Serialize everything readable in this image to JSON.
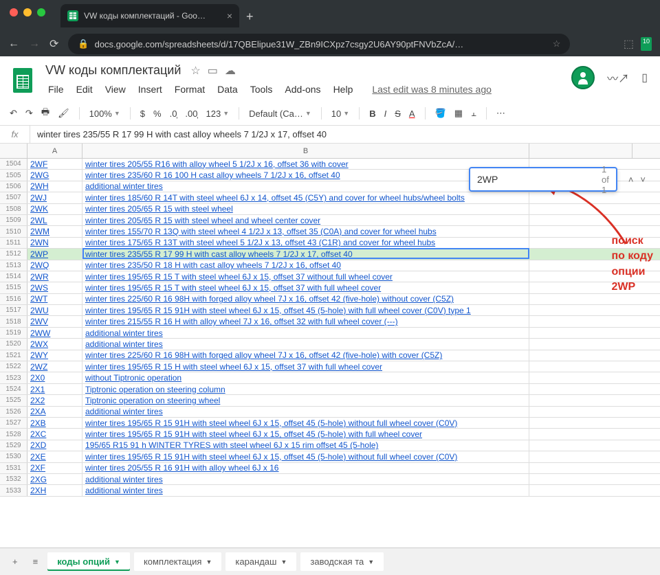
{
  "browser": {
    "tab_title": "VW коды комплектаций - Goo…",
    "url": "docs.google.com/spreadsheets/d/17QBElipue31W_ZBn9ICXpz7csgy2U6AY90ptFNVbZcA/…",
    "ext_badge": "10"
  },
  "doc": {
    "title": "VW коды комплектаций",
    "last_edit": "Last edit was 8 minutes ago",
    "menu": [
      "File",
      "Edit",
      "View",
      "Insert",
      "Format",
      "Data",
      "Tools",
      "Add-ons",
      "Help"
    ]
  },
  "toolbar": {
    "zoom": "100%",
    "font": "Default (Ca…",
    "size": "10"
  },
  "formula": "winter tires 235/55 R 17 99 H with cast alloy wheels 7 1/2J x 17, offset 40",
  "find": {
    "value": "2WP",
    "count": "1 of 1"
  },
  "columns": [
    "A",
    "B"
  ],
  "active_cell": {
    "row": 1512,
    "col": "B"
  },
  "highlight_row": 1512,
  "rows": [
    {
      "n": 1504,
      "a": "2WF",
      "b": "winter tires 205/55 R16 with alloy wheel 5 1/2J x 16, offset 36 with cover"
    },
    {
      "n": 1505,
      "a": "2WG",
      "b": "winter tires 235/60 R 16 100 H cast alloy wheels 7 1/2J x 16, offset 40"
    },
    {
      "n": 1506,
      "a": "2WH",
      "b": "additional winter tires"
    },
    {
      "n": 1507,
      "a": "2WJ",
      "b": "winter tires 185/60 R 14T with steel wheel 6J x 14, offset 45 (C5Y) and cover for wheel hubs/wheel bolts"
    },
    {
      "n": 1508,
      "a": "2WK",
      "b": "winter tires 205/65 R 15 with steel wheel"
    },
    {
      "n": 1509,
      "a": "2WL",
      "b": "winter tires 205/65 R 15 with steel wheel and wheel center cover"
    },
    {
      "n": 1510,
      "a": "2WM",
      "b": "winter tires 155/70 R 13Q with steel wheel 4 1/2J x 13, offset 35 (C0A) and cover for wheel hubs"
    },
    {
      "n": 1511,
      "a": "2WN",
      "b": "winter tires 175/65 R 13T with steel wheel 5 1/2J x 13, offset 43 (C1R) and cover for wheel hubs"
    },
    {
      "n": 1512,
      "a": "2WP",
      "b": "winter tires 235/55 R 17 99 H with cast alloy wheels 7 1/2J x 17, offset 40"
    },
    {
      "n": 1513,
      "a": "2WQ",
      "b": "winter tires 235/50 R 18 H with cast alloy wheels 7 1/2J x 16, offset 40"
    },
    {
      "n": 1514,
      "a": "2WR",
      "b": "winter tires 195/65 R 15 T with steel wheel 6J x 15, offset 37 without full wheel cover"
    },
    {
      "n": 1515,
      "a": "2WS",
      "b": "winter tires 195/65 R 15 T with steel wheel 6J x 15, offset 37 with full wheel cover"
    },
    {
      "n": 1516,
      "a": "2WT",
      "b": "winter tires 225/60 R 16 98H with forged alloy wheel 7J x 16, offset 42 (five-hole) without cover (C5Z)"
    },
    {
      "n": 1517,
      "a": "2WU",
      "b": "winter tires 195/65 R 15 91H with steel wheel 6J x 15, offset 45 (5-hole) with full wheel cover (C0V) type 1"
    },
    {
      "n": 1518,
      "a": "2WV",
      "b": "winter tires 215/55 R 16 H with alloy wheel 7J x 16, offset 32 with full wheel cover (---)"
    },
    {
      "n": 1519,
      "a": "2WW",
      "b": "additional winter tires"
    },
    {
      "n": 1520,
      "a": "2WX",
      "b": "additional winter tires"
    },
    {
      "n": 1521,
      "a": "2WY",
      "b": "winter tires 225/60 R 16 98H with forged alloy wheel 7J x 16, offset 42 (five-hole) with cover (C5Z)"
    },
    {
      "n": 1522,
      "a": "2WZ",
      "b": "winter tires 195/65 R 15 H with steel wheel 6J x 15, offset 37 with full wheel cover"
    },
    {
      "n": 1523,
      "a": "2X0",
      "b": "without Tiptronic operation"
    },
    {
      "n": 1524,
      "a": "2X1",
      "b": "Tiptronic operation on steering column"
    },
    {
      "n": 1525,
      "a": "2X2",
      "b": "Tiptronic operation on steering wheel"
    },
    {
      "n": 1526,
      "a": "2XA",
      "b": "additional winter tires"
    },
    {
      "n": 1527,
      "a": "2XB",
      "b": "winter tires 195/65 R 15 91H with steel wheel 6J x 15, offset 45 (5-hole) without full wheel cover (C0V)"
    },
    {
      "n": 1528,
      "a": "2XC",
      "b": "winter tires 195/65 R 15 91H with steel wheel 6J x 15, offset 45 (5-hole) with full wheel cover"
    },
    {
      "n": 1529,
      "a": "2XD",
      "b": "195/65 R15 91 h WINTER TYRES with steel wheel 6J x 15 rim offset 45 (5-hole)"
    },
    {
      "n": 1530,
      "a": "2XE",
      "b": "winter tires 195/65 R 15 91H with steel wheel 6J x 15, offset 45 (5-hole) without full wheel cover (C0V)"
    },
    {
      "n": 1531,
      "a": "2XF",
      "b": "winter tires 205/55 R 16 91H with alloy wheel 6J x 16"
    },
    {
      "n": 1532,
      "a": "2XG",
      "b": "additional winter tires"
    },
    {
      "n": 1533,
      "a": "2XH",
      "b": "additional winter tires"
    }
  ],
  "annotation": "поиск\nпо коду\nопции\n2WP",
  "tabs": {
    "items": [
      "коды опций",
      "комплектация",
      "карандаш",
      "заводская та"
    ],
    "active": 0
  }
}
